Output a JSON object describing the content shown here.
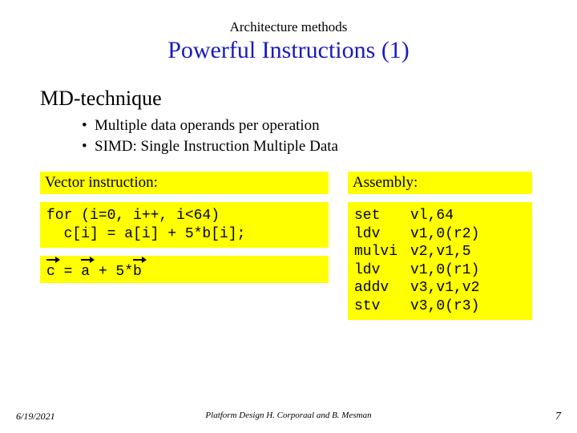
{
  "pretitle": "Architecture methods",
  "title": "Powerful Instructions (1)",
  "subtitle": "MD-technique",
  "bullets": [
    "Multiple data operands per operation",
    "SIMD: Single Instruction Multiple Data"
  ],
  "left": {
    "heading": "Vector instruction:",
    "code": "for (i=0, i++, i<64)\n  c[i] = a[i] + 5*b[i];",
    "vec_c": "c",
    "vec_eq": " = ",
    "vec_a": "a",
    "vec_plus": " + 5*",
    "vec_b": "b"
  },
  "right": {
    "heading": "Assembly:",
    "rows": [
      {
        "op": "set",
        "args": "vl,64"
      },
      {
        "op": "ldv",
        "args": "v1,0(r2)"
      },
      {
        "op": "mulvi",
        "args": "v2,v1,5"
      },
      {
        "op": "ldv",
        "args": "v1,0(r1)"
      },
      {
        "op": "addv",
        "args": "v3,v1,v2"
      },
      {
        "op": "stv",
        "args": "v3,0(r3)"
      }
    ]
  },
  "footer": {
    "date": "6/19/2021",
    "mid": "Platform Design     H. Corporaal and B. Mesman",
    "page": "7"
  }
}
